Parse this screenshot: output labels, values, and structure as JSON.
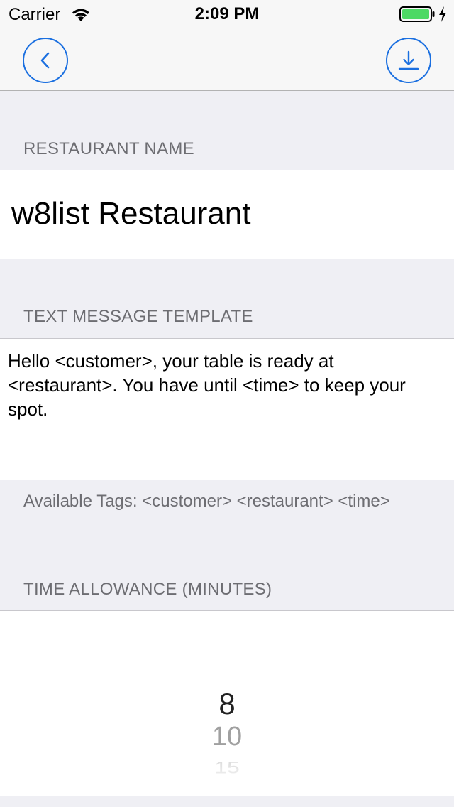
{
  "status_bar": {
    "carrier": "Carrier",
    "time": "2:09 PM",
    "battery_level": 1.0,
    "battery_color": "#4cd964"
  },
  "nav_bar": {
    "back_icon": "chevron-left-icon",
    "download_icon": "download-icon",
    "accent_color": "#1a6fe0"
  },
  "restaurant_name": {
    "header": "RESTAURANT NAME",
    "value": "w8list Restaurant"
  },
  "text_message": {
    "header": "TEXT MESSAGE TEMPLATE",
    "value": "Hello <customer>, your table is ready at <restaurant>. You have until <time> to keep your spot.",
    "footer": "Available Tags: <customer> <restaurant> <time>"
  },
  "time_allowance": {
    "header": "TIME ALLOWANCE (MINUTES)",
    "options_visible": [
      "8",
      "10",
      "15"
    ],
    "selected": "8"
  }
}
